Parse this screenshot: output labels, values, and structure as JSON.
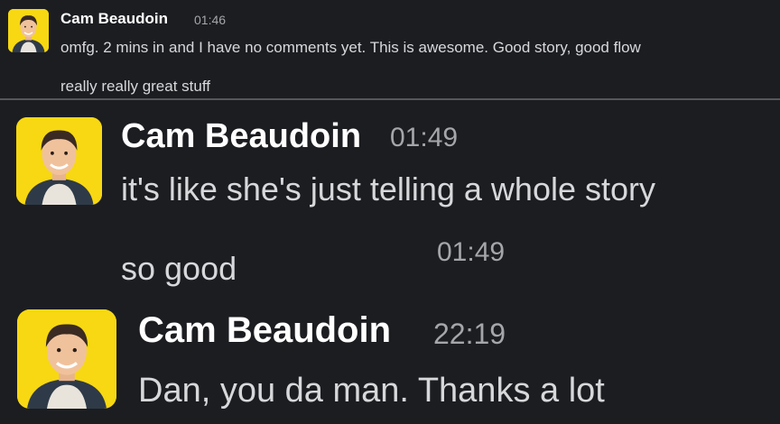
{
  "colors": {
    "background": "#1c1d21",
    "name": "#ffffff",
    "message": "#d7d8da",
    "timestamp": "#a5a6aa",
    "divider": "#56575b",
    "avatar_bg": "#f7d812"
  },
  "top_message": {
    "author": "Cam Beaudoin",
    "time": "01:46",
    "line1": "omfg. 2 mins in and I have no comments yet. This is awesome. Good story, good flow",
    "line2": "really really great stuff",
    "avatar_icon": "user-avatar-icon"
  },
  "messages": [
    {
      "author": "Cam Beaudoin",
      "time": "01:49",
      "text": "it's like she's just telling a whole story",
      "avatar_icon": "user-avatar-icon"
    },
    {
      "time": "01:49",
      "text": "so good"
    },
    {
      "author": "Cam Beaudoin",
      "time": "22:19",
      "text": "Dan, you da man. Thanks a lot",
      "avatar_icon": "user-avatar-icon"
    }
  ]
}
